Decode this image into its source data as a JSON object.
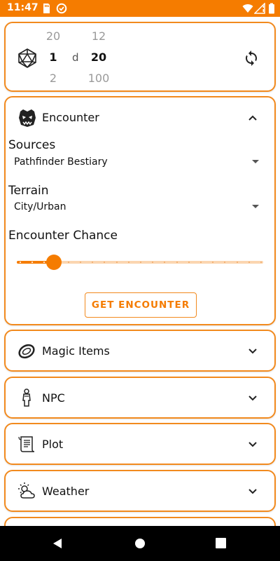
{
  "status_bar": {
    "time": "11:47"
  },
  "dice_roller": {
    "count_column": {
      "above": "20",
      "selected": "1",
      "below": "2"
    },
    "separator": "d",
    "sides_column": {
      "above": "12",
      "selected": "20",
      "below": "100"
    }
  },
  "encounter": {
    "title": "Encounter",
    "sources_label": "Sources",
    "sources_value": "Pathfinder Bestiary",
    "terrain_label": "Terrain",
    "terrain_value": "City/Urban",
    "chance_label": "Encounter Chance",
    "chance_slider": {
      "value": 3,
      "min": 0,
      "max": 20
    },
    "button_label": "GET ENCOUNTER"
  },
  "sections": [
    {
      "label": "Magic Items",
      "icon": "ring-icon"
    },
    {
      "label": "NPC",
      "icon": "person-icon"
    },
    {
      "label": "Plot",
      "icon": "scroll-icon"
    },
    {
      "label": "Weather",
      "icon": "weather-icon"
    }
  ],
  "colors": {
    "accent": "#f57c00",
    "border": "#f28a1e",
    "track": "#fbd6b0"
  }
}
